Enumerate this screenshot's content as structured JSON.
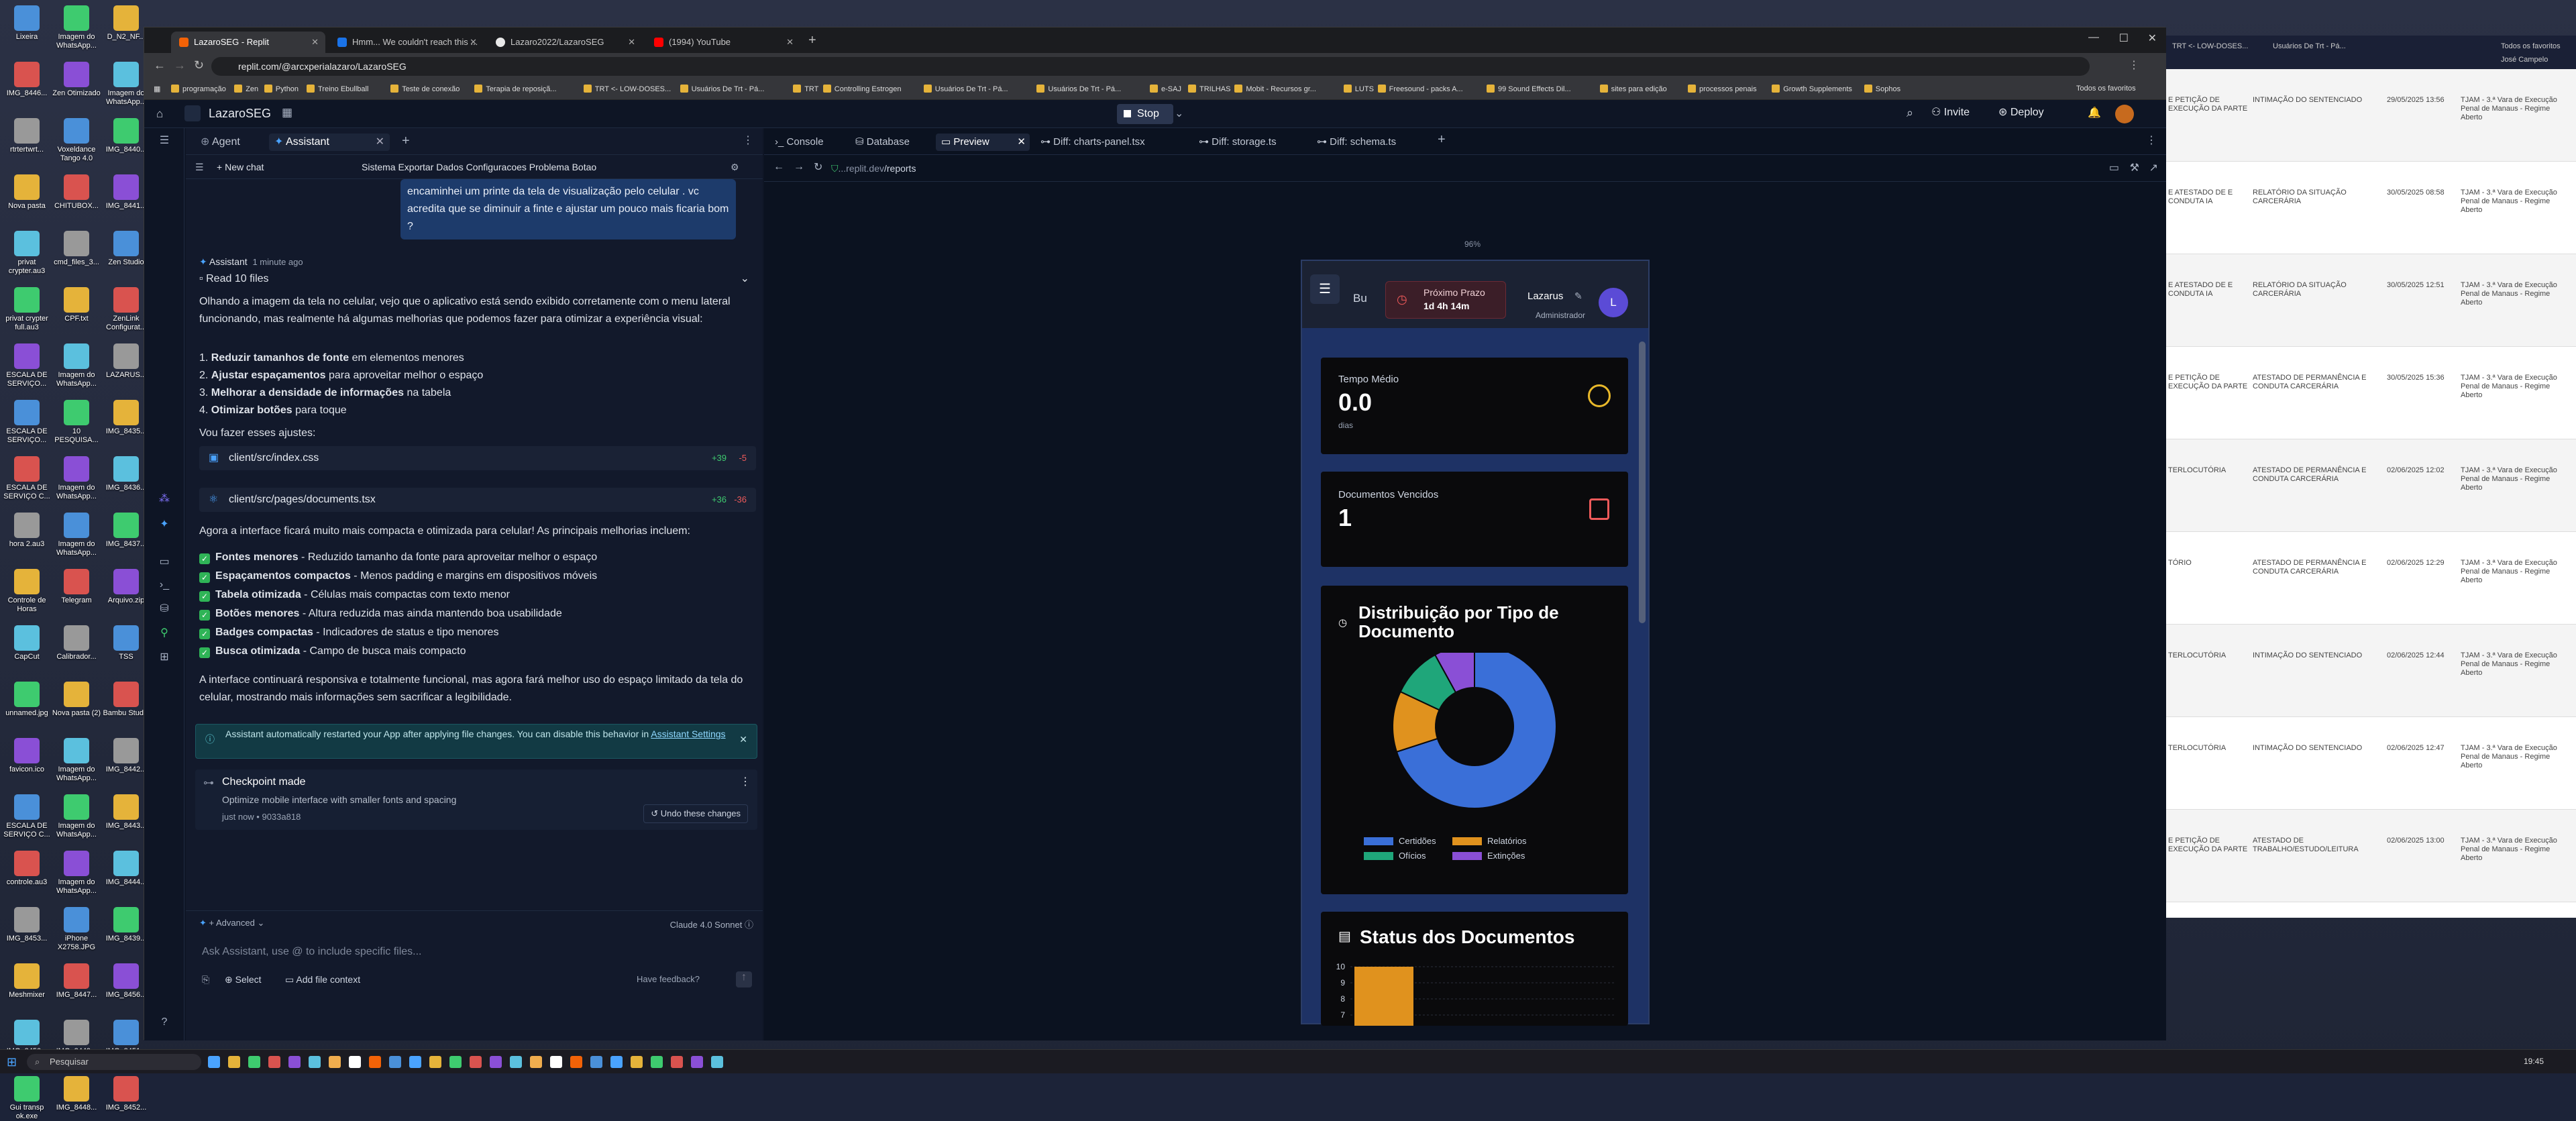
{
  "desktop": {
    "icons": [
      {
        "label": "Lixeira"
      },
      {
        "label": "Imagem do WhatsApp..."
      },
      {
        "label": "D_N2_NF..."
      },
      {
        "label": "IMG_8446..."
      },
      {
        "label": "Zen Otimizado"
      },
      {
        "label": "Imagem do WhatsApp..."
      },
      {
        "label": "rtrtertwrt..."
      },
      {
        "label": "Voxeldance Tango 4.0"
      },
      {
        "label": "IMG_8440..."
      },
      {
        "label": "Nova pasta"
      },
      {
        "label": "CHITUBOX..."
      },
      {
        "label": "IMG_8441..."
      },
      {
        "label": "privat crypter.au3"
      },
      {
        "label": "cmd_files_3..."
      },
      {
        "label": "Zen Studio"
      },
      {
        "label": "privat crypter full.au3"
      },
      {
        "label": "CPF.txt"
      },
      {
        "label": "ZenLink Configurat..."
      },
      {
        "label": "ESCALA DE SERVIÇO..."
      },
      {
        "label": "Imagem do WhatsApp..."
      },
      {
        "label": "LAZARUS..."
      },
      {
        "label": "ESCALA DE SERVIÇO..."
      },
      {
        "label": "10 PESQUISA..."
      },
      {
        "label": "IMG_8435..."
      },
      {
        "label": "ESCALA DE SERVIÇO C..."
      },
      {
        "label": "Imagem do WhatsApp..."
      },
      {
        "label": "IMG_8436..."
      },
      {
        "label": "hora 2.au3"
      },
      {
        "label": "Imagem do WhatsApp..."
      },
      {
        "label": "IMG_8437..."
      },
      {
        "label": "Controle de Horas"
      },
      {
        "label": "Telegram"
      },
      {
        "label": "Arquivo.zip"
      },
      {
        "label": "CapCut"
      },
      {
        "label": "Calibrador..."
      },
      {
        "label": "TSS"
      },
      {
        "label": "unnamed.jpg"
      },
      {
        "label": "Nova pasta (2)"
      },
      {
        "label": "Bambu Studio"
      },
      {
        "label": "favicon.ico"
      },
      {
        "label": "Imagem do WhatsApp..."
      },
      {
        "label": "IMG_8442..."
      },
      {
        "label": "ESCALA DE SERVIÇO C..."
      },
      {
        "label": "Imagem do WhatsApp..."
      },
      {
        "label": "IMG_8443..."
      },
      {
        "label": "controle.au3"
      },
      {
        "label": "Imagem do WhatsApp..."
      },
      {
        "label": "IMG_8444..."
      },
      {
        "label": "IMG_8453..."
      },
      {
        "label": "iPhone X2758.JPG"
      },
      {
        "label": "IMG_8439..."
      },
      {
        "label": "Meshmixer"
      },
      {
        "label": "IMG_8447..."
      },
      {
        "label": "IMG_8456..."
      },
      {
        "label": "IMG_8450..."
      },
      {
        "label": "IMG_8449..."
      },
      {
        "label": "IMG_8451..."
      },
      {
        "label": "Gui transp ok.exe"
      },
      {
        "label": "IMG_8448..."
      },
      {
        "label": "IMG_8452..."
      }
    ]
  },
  "taskbar": {
    "search_placeholder": "Pesquisar",
    "clock": "19:45"
  },
  "browser": {
    "tabs": [
      {
        "title": "LazaroSEG - Replit",
        "color": "#f26207"
      },
      {
        "title": "Hmm... We couldn't reach this ...",
        "color": "#1a73e8"
      },
      {
        "title": "Lazaro2022/LazaroSEG",
        "color": "#e8e8e8"
      },
      {
        "title": "(1994) YouTube",
        "color": "#ff0000"
      }
    ],
    "url": "replit.com/@arcxperialazaro/LazaroSEG",
    "bookmarks": [
      "programação",
      "Zen",
      "Python",
      "Treino Ebullball",
      "Teste de conexão",
      "Terapia de reposiçã...",
      "TRT <- LOW-DOSES...",
      "Usuários De Trt - Pá...",
      "TRT",
      "Controlling Estrogen",
      "Usuários De Trt - Pá...",
      "Usuários De Trt - Pá...",
      "e-SAJ",
      "TRILHAS",
      "Mobit - Recursos gr...",
      "LUTS",
      "Freesound - packs A...",
      "99 Sound Effects Dil...",
      "sites para edição",
      "processos penais",
      "Growth Supplements",
      "Sophos"
    ],
    "all_bookmarks": "Todos os favoritos"
  },
  "replit": {
    "project_name": "LazaroSEG",
    "stop_label": "Stop",
    "invite_label": "Invite",
    "deploy_label": "Deploy",
    "chat_tabs": {
      "agent": "Agent",
      "assistant": "Assistant"
    },
    "new_chat": "New chat",
    "chat_title": "Sistema Exportar Dados Configuracoes Problema Botao",
    "user_message": "encaminhei um printe da tela de visualização pelo celular . vc acredita que se diminuir a finte e ajustar um pouco mais ficaria bom ?",
    "assistant_name": "Assistant",
    "assistant_time": "1 minute ago",
    "read_files": "Read 10 files",
    "intro": "Olhando a imagem da tela no celular, vejo que o aplicativo está sendo exibido corretamente com o menu lateral funcionando, mas realmente há algumas melhorias que podemos fazer para otimizar a experiência visual:",
    "improvements": [
      {
        "n": "1.",
        "bold": "Reduzir tamanhos de fonte",
        "rest": " em elementos menores"
      },
      {
        "n": "2.",
        "bold": "Ajustar espaçamentos",
        "rest": " para aproveitar melhor o espaço"
      },
      {
        "n": "3.",
        "bold": "Melhorar a densidade de informações",
        "rest": " na tabela"
      },
      {
        "n": "4.",
        "bold": "Otimizar botões",
        "rest": " para toque"
      }
    ],
    "doing": "Vou fazer esses ajustes:",
    "files": [
      {
        "name": "client/src/index.css",
        "adds": "+39",
        "dels": "-5"
      },
      {
        "name": "client/src/pages/documents.tsx",
        "adds": "+36",
        "dels": "-36"
      }
    ],
    "summary": "Agora a interface ficará muito mais compacta e otimizada para celular! As principais melhorias incluem:",
    "checks": [
      {
        "bold": "Fontes menores",
        "rest": " - Reduzido tamanho da fonte para aproveitar melhor o espaço"
      },
      {
        "bold": "Espaçamentos compactos",
        "rest": " - Menos padding e margins em dispositivos móveis"
      },
      {
        "bold": "Tabela otimizada",
        "rest": " - Células mais compactas com texto menor"
      },
      {
        "bold": "Botões menores",
        "rest": " - Altura reduzida mas ainda mantendo boa usabilidade"
      },
      {
        "bold": "Badges compactas",
        "rest": " - Indicadores de status e tipo menores"
      },
      {
        "bold": "Busca otimizada",
        "rest": " - Campo de busca mais compacto"
      }
    ],
    "closing": "A interface continuará responsiva e totalmente funcional, mas agora fará melhor uso do espaço limitado da tela do celular, mostrando mais informações sem sacrificar a legibilidade.",
    "notice": "Assistant automatically restarted your App after applying file changes. You can disable this behavior in",
    "notice_link": "Assistant Settings",
    "checkpoint_title": "Checkpoint made",
    "checkpoint_desc": "Optimize mobile interface with smaller fonts and spacing",
    "checkpoint_meta": "just now • 9033a818",
    "undo_label": "Undo these changes",
    "advanced_label": "Advanced",
    "model_label": "Claude 4.0 Sonnet",
    "input_placeholder": "Ask Assistant, use @ to include specific files...",
    "select_label": "Select",
    "add_file_context": "Add file context",
    "feedback_label": "Have feedback?",
    "main_tabs": [
      "Console",
      "Database",
      "Preview",
      "Diff: charts-panel.tsx",
      "Diff: storage.ts",
      "Diff: schema.ts"
    ],
    "preview_url_prefix": "...replit.dev",
    "preview_url_path": "/reports",
    "zoom": "96%"
  },
  "app": {
    "brand_short": "Bu",
    "next_deadline_label": "Próximo Prazo",
    "next_deadline_value": "1d 4h 14m",
    "user_name": "Lazarus",
    "user_role": "Administrador",
    "avatar_letter": "L",
    "avg_time_label": "Tempo Médio",
    "avg_time_value": "0.0",
    "avg_time_unit": "dias",
    "overdue_label": "Documentos Vencidos",
    "overdue_value": "1",
    "doc_type_title": "Distribuição por Tipo de Documento",
    "status_title": "Status dos Documentos"
  },
  "chart_data": [
    {
      "type": "pie",
      "title": "Distribuição por Tipo de Documento",
      "categories": [
        "Certidões",
        "Relatórios",
        "Ofícios",
        "Extinções"
      ],
      "values": [
        70,
        12,
        10,
        8
      ],
      "colors": [
        "#3a6fd8",
        "#e0921e",
        "#1fa67a",
        "#8a4fd6"
      ],
      "legend": "bottom"
    },
    {
      "type": "bar",
      "title": "Status dos Documentos",
      "categories": [
        ""
      ],
      "values": [
        10
      ],
      "ylim": [
        0,
        10
      ],
      "yticks": [
        "10",
        "9",
        "8",
        "7"
      ],
      "color": "#e0921e"
    }
  ],
  "right_window": {
    "tabs": [
      "TRT <- LOW-DOSES...",
      "Usuários De Trt - Pá...",
      "Todos os favoritos"
    ],
    "user": "José Campelo",
    "rows": [
      {
        "a": "E PETIÇÃO DE EXECUÇÃO DA PARTE",
        "b": "INTIMAÇÃO DO SENTENCIADO",
        "date": "29/05/2025 13:56"
      },
      {
        "a": "E ATESTADO DE E CONDUTA IA",
        "b": "RELATÓRIO DA SITUAÇÃO CARCERÁRIA",
        "date": "30/05/2025 08:58"
      },
      {
        "a": "E ATESTADO DE E CONDUTA IA",
        "b": "RELATÓRIO DA SITUAÇÃO CARCERÁRIA",
        "date": "30/05/2025 12:51"
      },
      {
        "a": "E PETIÇÃO DE EXECUÇÃO DA PARTE",
        "b": "ATESTADO DE PERMANÊNCIA E CONDUTA CARCERÁRIA",
        "date": "30/05/2025 15:36"
      },
      {
        "a": "TERLOCUTÓRIA",
        "b": "ATESTADO DE PERMANÊNCIA E CONDUTA CARCERÁRIA",
        "date": "02/06/2025 12:02"
      },
      {
        "a": "TÓRIO",
        "b": "ATESTADO DE PERMANÊNCIA E CONDUTA CARCERÁRIA",
        "date": "02/06/2025 12:29"
      },
      {
        "a": "TERLOCUTÓRIA",
        "b": "INTIMAÇÃO DO SENTENCIADO",
        "date": "02/06/2025 12:44"
      },
      {
        "a": "TERLOCUTÓRIA",
        "b": "INTIMAÇÃO DO SENTENCIADO",
        "date": "02/06/2025 12:47"
      },
      {
        "a": "E PETIÇÃO DE EXECUÇÃO DA PARTE",
        "b": "ATESTADO DE TRABALHO/ESTUDO/LEITURA",
        "date": "02/06/2025 13:00"
      }
    ],
    "court": "TJAM - 3.ª Vara de Execução Penal de Manaus - Regime Aberto"
  }
}
